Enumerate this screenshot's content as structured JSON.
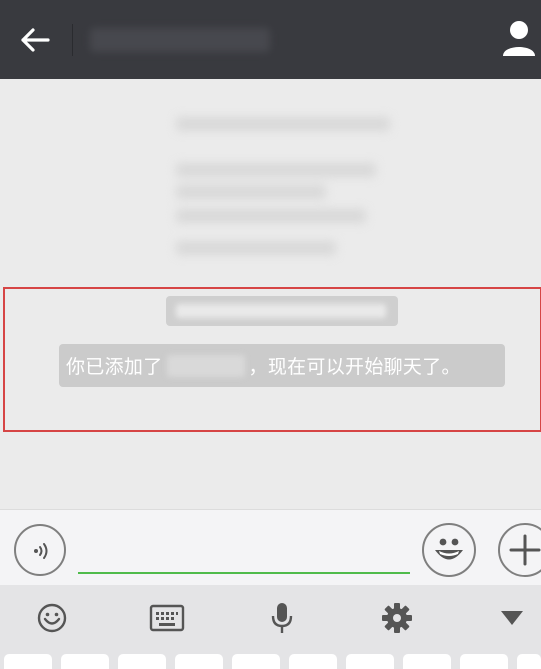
{
  "header": {
    "back_icon": "arrow-left-icon",
    "profile_icon": "person-icon"
  },
  "chat": {
    "system_message": {
      "prefix": "你已添加了",
      "suffix": "，现在可以开始聊天了。"
    }
  },
  "input_bar": {
    "voice_icon": "voice-icon",
    "emoji_icon": "emoji-face-icon",
    "plus_icon": "plus-icon",
    "text_value": "",
    "placeholder": ""
  },
  "toolbar": {
    "items": [
      "emoji-icon",
      "keyboard-icon",
      "microphone-icon",
      "gear-icon",
      "triangle-down-icon"
    ]
  },
  "colors": {
    "header_bg": "#393a3f",
    "chat_bg": "#ebebeb",
    "input_underline": "#4fbb4b",
    "highlight_border": "#d64545"
  }
}
